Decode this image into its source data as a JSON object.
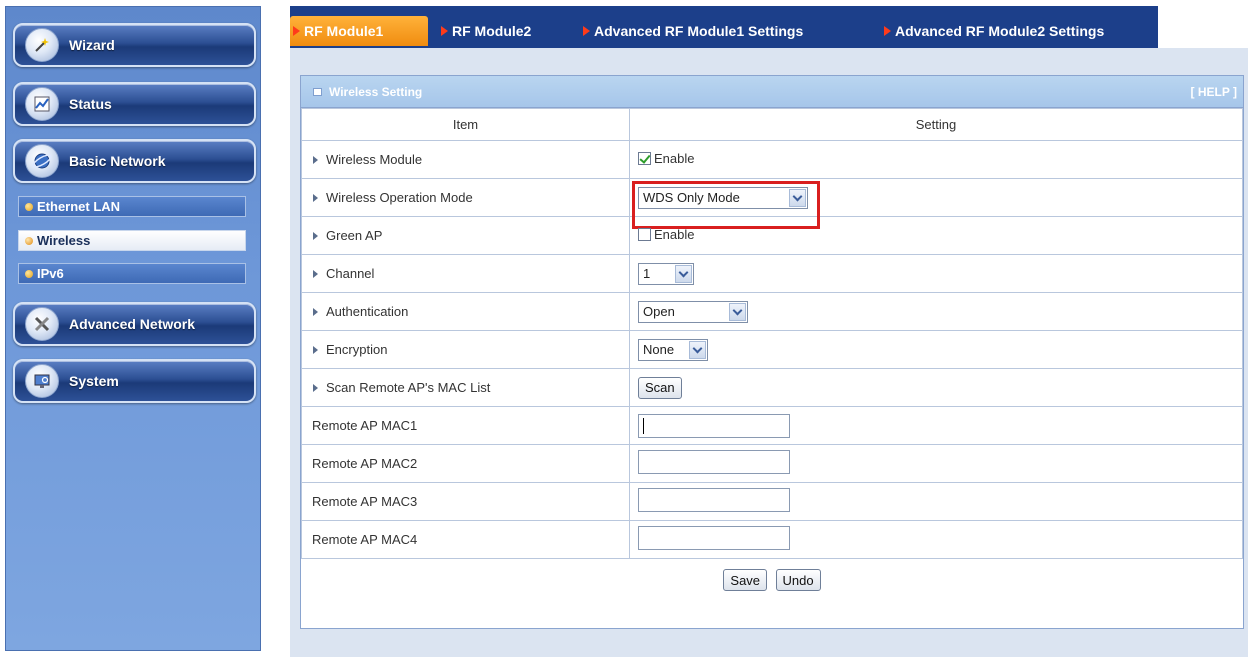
{
  "sidebar": {
    "items": [
      {
        "label": "Wizard",
        "icon": "wand-icon"
      },
      {
        "label": "Status",
        "icon": "chart-icon"
      },
      {
        "label": "Basic Network",
        "icon": "globe-icon"
      },
      {
        "label": "Advanced Network",
        "icon": "tools-icon"
      },
      {
        "label": "System",
        "icon": "monitor-icon"
      }
    ],
    "subitems": [
      {
        "label": "Ethernet LAN",
        "active": false
      },
      {
        "label": "Wireless",
        "active": true
      },
      {
        "label": "IPv6",
        "active": false
      }
    ]
  },
  "tabs": [
    {
      "label": "RF Module1",
      "active": true
    },
    {
      "label": "RF Module2",
      "active": false
    },
    {
      "label": "Advanced RF Module1 Settings",
      "active": false
    },
    {
      "label": "Advanced RF Module2 Settings",
      "active": false
    }
  ],
  "panel": {
    "title": "Wireless Setting",
    "help": "[ HELP ]"
  },
  "table": {
    "headers": [
      "Item",
      "Setting"
    ],
    "rows": {
      "wireless_module": {
        "label": "Wireless Module",
        "checkbox_label": "Enable",
        "checked": true
      },
      "operation_mode": {
        "label": "Wireless Operation Mode",
        "value": "WDS Only Mode"
      },
      "green_ap": {
        "label": "Green AP",
        "checkbox_label": "Enable",
        "checked": false
      },
      "channel": {
        "label": "Channel",
        "value": "1"
      },
      "authentication": {
        "label": "Authentication",
        "value": "Open"
      },
      "encryption": {
        "label": "Encryption",
        "value": "None"
      },
      "scan": {
        "label": "Scan Remote AP's MAC List",
        "button": "Scan"
      },
      "mac1": {
        "label": "Remote AP MAC1",
        "value": ""
      },
      "mac2": {
        "label": "Remote AP MAC2",
        "value": ""
      },
      "mac3": {
        "label": "Remote AP MAC3",
        "value": ""
      },
      "mac4": {
        "label": "Remote AP MAC4",
        "value": ""
      }
    }
  },
  "actions": {
    "save": "Save",
    "undo": "Undo"
  },
  "colors": {
    "highlight": "#d91f1f",
    "active_tab": "#f08c10",
    "tabbar": "#1c3f8a"
  }
}
